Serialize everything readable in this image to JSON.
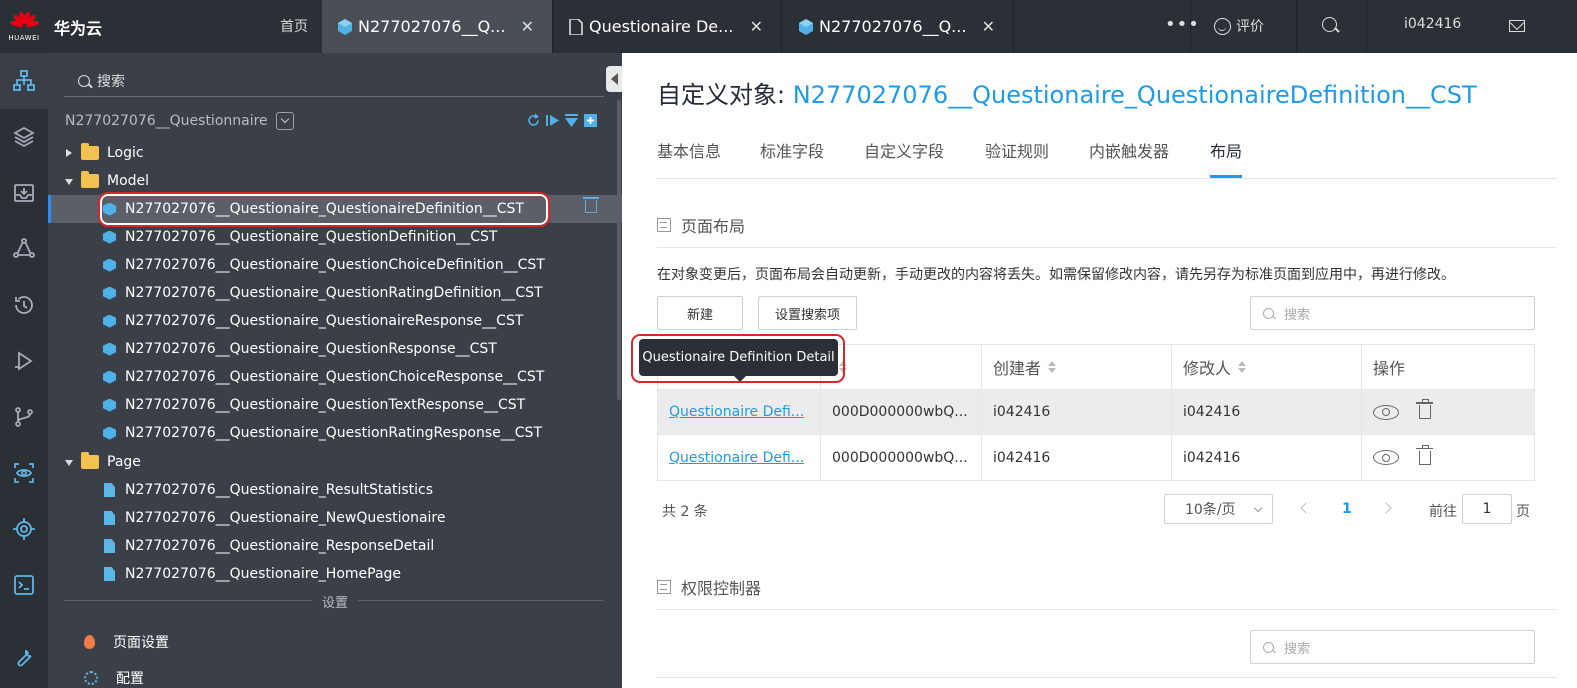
{
  "topbar": {
    "logo_text": "HUAWEI",
    "brand": "华为云",
    "home": "首页",
    "tabs": [
      {
        "label": "N277027076__Q...",
        "icon": "cube-icon",
        "active": true
      },
      {
        "label": "Questionaire De...",
        "icon": "file-icon",
        "active": false
      },
      {
        "label": "N277027076__Q...",
        "icon": "cube-icon",
        "active": false
      }
    ],
    "close_glyph": "✕",
    "more": "•••",
    "rate": "评价",
    "user": "i042416"
  },
  "tree": {
    "search_placeholder": "搜索",
    "project": "N277027076__Questionnaire",
    "folders": {
      "logic": "Logic",
      "model": "Model",
      "page": "Page"
    },
    "models": [
      "N277027076__Questionaire_QuestionaireDefinition__CST",
      "N277027076__Questionaire_QuestionDefinition__CST",
      "N277027076__Questionaire_QuestionChoiceDefinition__CST",
      "N277027076__Questionaire_QuestionRatingDefinition__CST",
      "N277027076__Questionaire_QuestionaireResponse__CST",
      "N277027076__Questionaire_QuestionResponse__CST",
      "N277027076__Questionaire_QuestionChoiceResponse__CST",
      "N277027076__Questionaire_QuestionTextResponse__CST",
      "N277027076__Questionaire_QuestionRatingResponse__CST"
    ],
    "pages": [
      "N277027076__Questionaire_ResultStatistics",
      "N277027076__Questionaire_NewQuestionaire",
      "N277027076__Questionaire_ResponseDetail",
      "N277027076__Questionaire_HomePage"
    ],
    "settings_label": "设置",
    "menu": {
      "page_settings": "页面设置",
      "config": "配置"
    }
  },
  "main": {
    "title_prefix": "自定义对象: ",
    "title_object": "N277027076__Questionaire_QuestionaireDefinition__CST",
    "tabs": [
      "基本信息",
      "标准字段",
      "自定义字段",
      "验证规则",
      "内嵌触发器",
      "布局"
    ],
    "section_layout": "页面布局",
    "notice": "在对象变更后，页面布局会自动更新，手动更改的内容将丢失。如需保留修改内容，请先另存为标准页面到应用中，再进行修改。",
    "btn_new": "新建",
    "btn_search_settings": "设置搜索项",
    "search_placeholder": "搜索",
    "table": {
      "headers": [
        "",
        "",
        "创建者",
        "修改人",
        "操作"
      ],
      "rows": [
        {
          "name": "Questionaire Defi...",
          "id": "000D000000wbQ...",
          "creator": "i042416",
          "modifier": "i042416"
        },
        {
          "name": "Questionaire Defi...",
          "id": "000D000000wbQ...",
          "creator": "i042416",
          "modifier": "i042416"
        }
      ]
    },
    "tooltip": "Questionaire Definition Detail",
    "pager": {
      "total": "共 2 条",
      "page_size": "10条/页",
      "current": "1",
      "goto_label": "前往",
      "goto_value": "1",
      "goto_suffix": "页"
    },
    "section_permission": "权限控制器"
  },
  "colors": {
    "accent": "#1e9be8",
    "topbar": "#2b2f36",
    "tree_bg": "#3b4048",
    "highlight": "#d9252c"
  }
}
